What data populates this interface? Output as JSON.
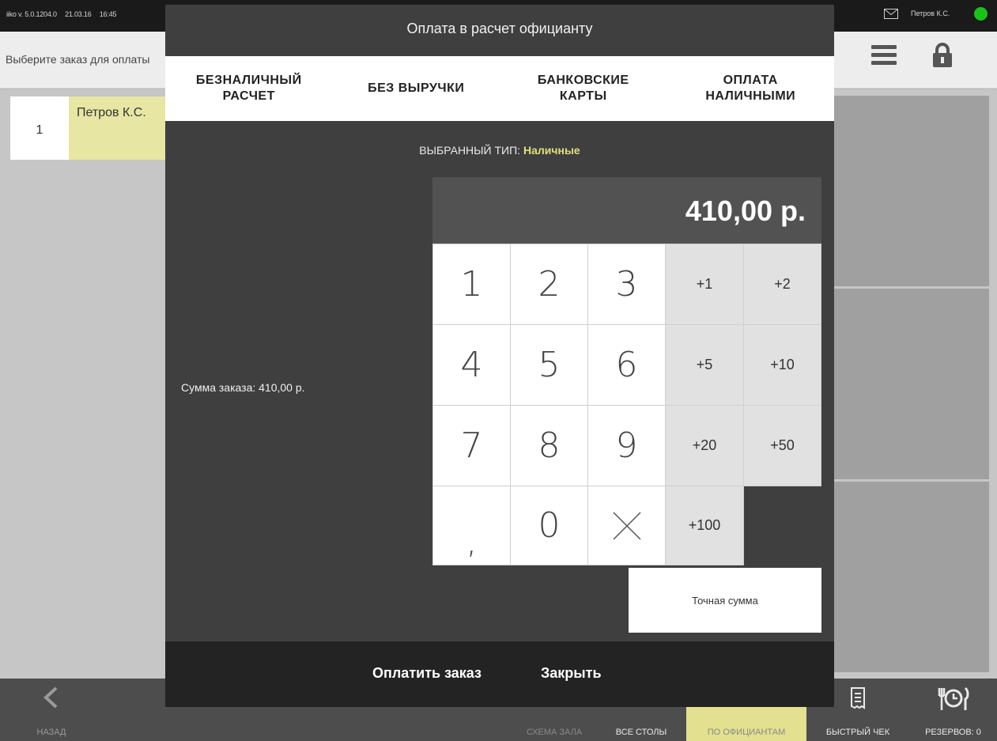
{
  "topbar": {
    "version": "iiko v. 5.0.1204.0",
    "date": "21.03.16",
    "time": "16:45",
    "user": "Петров К.С."
  },
  "subbar": {
    "hint": "Выберите заказ для оплаты"
  },
  "order": {
    "number": "1",
    "waiter": "Петров К.С."
  },
  "bottombar": {
    "back": "НАЗАД",
    "scheme": "СХЕМА ЗАЛА",
    "all_tables": "ВСЕ СТОЛЫ",
    "by_waiters": "ПО ОФИЦИАНТАМ",
    "quick_check": "БЫСТРЫЙ ЧЕК",
    "reservations": "РЕЗЕРВОВ: 0"
  },
  "modal": {
    "title": "Оплата в расчет официанту",
    "tabs": [
      "БЕЗНАЛИЧНЫЙ\nРАСЧЕТ",
      "БЕЗ ВЫРУЧКИ",
      "БАНКОВСКИЕ\nКАРТЫ",
      "ОПЛАТА\nНАЛИЧНЫМИ"
    ],
    "selected_type_label": "ВЫБРАННЫЙ ТИП:",
    "selected_type_value": "Наличные",
    "amount": "410,00 р.",
    "order_sum": "Сумма заказа: 410,00 р.",
    "keys": [
      "1",
      "2",
      "3",
      "4",
      "5",
      "6",
      "7",
      "8",
      "9",
      ",",
      "0"
    ],
    "add_keys": [
      "+1",
      "+2",
      "+5",
      "+10",
      "+20",
      "+50",
      "+100"
    ],
    "exact_sum": "Точная сумма",
    "pay_button": "Оплатить заказ",
    "close_button": "Закрыть"
  },
  "colors": {
    "status_online": "#19c219",
    "selected_type": "#dfe07a",
    "order_highlight": "#e7e6a3",
    "active_tab": "#e3e08f"
  }
}
